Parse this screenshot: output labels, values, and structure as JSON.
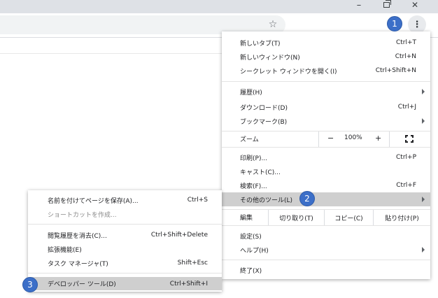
{
  "window_controls": {
    "minimize": "–",
    "close": "✕"
  },
  "toolbar": {
    "star_icon": "☆",
    "menu_icon": "⋮"
  },
  "main_menu": {
    "group1": [
      {
        "label": "新しいタブ(T)",
        "shortcut": "Ctrl+T"
      },
      {
        "label": "新しいウィンドウ(N)",
        "shortcut": "Ctrl+N"
      },
      {
        "label": "シークレット ウィンドウを開く(I)",
        "shortcut": "Ctrl+Shift+N"
      }
    ],
    "group2": [
      {
        "label": "履歴(H)",
        "shortcut": ""
      },
      {
        "label": "ダウンロード(D)",
        "shortcut": "Ctrl+J"
      },
      {
        "label": "ブックマーク(B)",
        "shortcut": ""
      }
    ],
    "zoom": {
      "label": "ズーム",
      "minus": "−",
      "value": "100%",
      "plus": "+"
    },
    "group3": [
      {
        "label": "印刷(P)...",
        "shortcut": "Ctrl+P"
      },
      {
        "label": "キャスト(C)...",
        "shortcut": ""
      },
      {
        "label": "検索(F)...",
        "shortcut": "Ctrl+F"
      },
      {
        "label": "その他のツール(L)",
        "shortcut": ""
      }
    ],
    "edit": {
      "label": "編集",
      "cut": "切り取り(T)",
      "copy": "コピー(C)",
      "paste": "貼り付け(P)"
    },
    "group4": [
      {
        "label": "設定(S)",
        "shortcut": ""
      },
      {
        "label": "ヘルプ(H)",
        "shortcut": ""
      }
    ],
    "exit": {
      "label": "終了(X)"
    }
  },
  "sub_menu": {
    "group1": [
      {
        "label": "名前を付けてページを保存(A)...",
        "shortcut": "Ctrl+S"
      },
      {
        "label": "ショートカットを作成...",
        "shortcut": ""
      }
    ],
    "group2": [
      {
        "label": "閲覧履歴を消去(C)...",
        "shortcut": "Ctrl+Shift+Delete"
      },
      {
        "label": "拡張機能(E)",
        "shortcut": ""
      },
      {
        "label": "タスク マネージャ(T)",
        "shortcut": "Shift+Esc"
      }
    ],
    "group3": [
      {
        "label": "デベロッパー ツール(D)",
        "shortcut": "Ctrl+Shift+I"
      }
    ]
  },
  "callouts": {
    "one": "1",
    "two": "2",
    "three": "3"
  },
  "colors": {
    "callout": "#3c6fc8",
    "highlight": "#cfcfcf",
    "titlebar": "#dee1e6"
  }
}
